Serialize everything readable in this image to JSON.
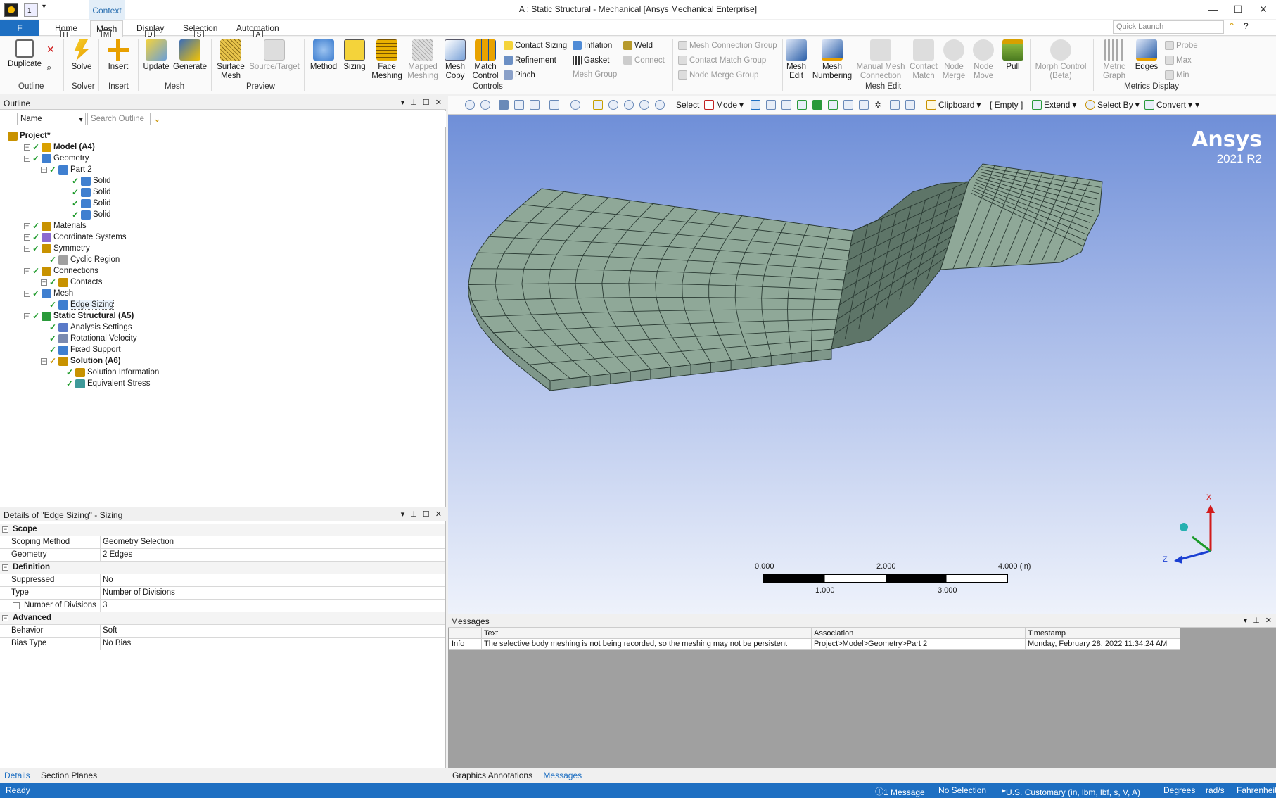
{
  "window": {
    "title": "A : Static Structural - Mechanical [Ansys Mechanical Enterprise]",
    "qat_badge": "1"
  },
  "context_tab": "Context",
  "tabs": [
    "Home",
    "Mesh",
    "Display",
    "Selection",
    "Automation"
  ],
  "file_tab": "F",
  "keytips": [
    "H",
    "M",
    "D",
    "S",
    "A"
  ],
  "quick_launch_placeholder": "Quick Launch",
  "ribbon": {
    "outline": {
      "duplicate": "Duplicate",
      "group": "Outline"
    },
    "solve": {
      "label": "Solve",
      "group": "Solver"
    },
    "insert": {
      "label": "Insert",
      "group": "Insert"
    },
    "mesh": {
      "update": "Update",
      "generate": "Generate",
      "group": "Mesh"
    },
    "preview": {
      "surface_mesh": "Surface Mesh",
      "source_target": "Source/Target",
      "group": "Preview"
    },
    "controls": {
      "method": "Method",
      "sizing": "Sizing",
      "face_meshing": "Face Meshing",
      "mapped_meshing": "Mapped Meshing",
      "mesh_copy": "Mesh Copy",
      "match_control": "Match Control",
      "group": "Controls"
    },
    "small1": {
      "contact_sizing": "Contact Sizing",
      "refinement": "Refinement",
      "pinch": "Pinch"
    },
    "small2": {
      "inflation": "Inflation",
      "gasket": "Gasket",
      "mesh_group": "Mesh Group"
    },
    "small3": {
      "weld": "Weld",
      "connect": "Connect"
    },
    "small4": {
      "mesh_connection_group": "Mesh Connection Group",
      "contact_match_group": "Contact Match Group",
      "node_merge_group": "Node Merge Group"
    },
    "meshedit": {
      "mesh_edit": "Mesh Edit",
      "mesh_numbering": "Mesh Numbering",
      "manual_mesh_connection": "Manual Mesh Connection",
      "contact_match": "Contact Match",
      "node_merge": "Node Merge",
      "node_move": "Node Move",
      "pull": "Pull",
      "group": "Mesh Edit"
    },
    "morph": "Morph Control (Beta)",
    "metrics": {
      "metric_graph": "Metric Graph",
      "edges": "Edges",
      "probe": "Probe",
      "max": "Max",
      "min": "Min",
      "group": "Metrics Display"
    }
  },
  "outline": {
    "title": "Outline",
    "filter": "Name",
    "search_placeholder": "Search Outline",
    "tree": [
      {
        "label": "Project*",
        "bold": true
      },
      {
        "label": "Model (A4)",
        "bold": true
      },
      {
        "label": "Geometry"
      },
      {
        "label": "Part 2"
      },
      {
        "label": "Solid"
      },
      {
        "label": "Solid"
      },
      {
        "label": "Solid"
      },
      {
        "label": "Solid"
      },
      {
        "label": "Materials"
      },
      {
        "label": "Coordinate Systems"
      },
      {
        "label": "Symmetry"
      },
      {
        "label": "Cyclic Region"
      },
      {
        "label": "Connections"
      },
      {
        "label": "Contacts"
      },
      {
        "label": "Mesh"
      },
      {
        "label": "Edge Sizing"
      },
      {
        "label": "Static Structural (A5)",
        "bold": true
      },
      {
        "label": "Analysis Settings"
      },
      {
        "label": "Rotational Velocity"
      },
      {
        "label": "Fixed Support"
      },
      {
        "label": "Solution (A6)",
        "bold": true
      },
      {
        "label": "Solution Information"
      },
      {
        "label": "Equivalent Stress"
      }
    ]
  },
  "details": {
    "title": "Details of \"Edge Sizing\" - Sizing",
    "rows": [
      {
        "section": "Scope"
      },
      {
        "k": "Scoping Method",
        "v": "Geometry Selection"
      },
      {
        "k": "Geometry",
        "v": "2 Edges"
      },
      {
        "section": "Definition"
      },
      {
        "k": "Suppressed",
        "v": "No"
      },
      {
        "k": "Type",
        "v": "Number of Divisions"
      },
      {
        "k": "Number of Divisions",
        "v": "3",
        "checkbox": true
      },
      {
        "section": "Advanced"
      },
      {
        "k": "Behavior",
        "v": "Soft"
      },
      {
        "k": "Bias Type",
        "v": "No Bias"
      }
    ]
  },
  "left_bottom_tabs": [
    "Details",
    "Section Planes"
  ],
  "viewport_toolbar": {
    "select": "Select",
    "mode": "Mode",
    "clipboard": "Clipboard",
    "empty": "[ Empty ]",
    "extend": "Extend",
    "select_by": "Select By",
    "convert": "Convert"
  },
  "brand": {
    "name": "Ansys",
    "version": "2021 R2"
  },
  "scale": {
    "top": [
      "0.000",
      "2.000",
      "4.000 (in)"
    ],
    "bottom": [
      "1.000",
      "3.000"
    ]
  },
  "triad": {
    "x": "X",
    "z": "Z"
  },
  "messages": {
    "title": "Messages",
    "headers": [
      "Text",
      "Association",
      "Timestamp"
    ],
    "rows": [
      {
        "type": "Info",
        "text": "The selective body meshing is not being recorded, so the meshing may not be persistent",
        "assoc": "Project>Model>Geometry>Part 2",
        "time": "Monday, February 28, 2022 11:34:24 AM"
      }
    ]
  },
  "right_bottom_tabs": [
    "Graphics Annotations",
    "Messages"
  ],
  "status": {
    "ready": "Ready",
    "messages": "1 Message",
    "selection": "No Selection",
    "units": "U.S. Customary (in, lbm, lbf, s, V, A)",
    "angle": "Degrees",
    "rot": "rad/s",
    "temp": "Fahrenheit"
  },
  "colors": {
    "accent": "#1e6fc2",
    "mesh_fill": "#8fa898",
    "mesh_line": "#2a3a33"
  }
}
